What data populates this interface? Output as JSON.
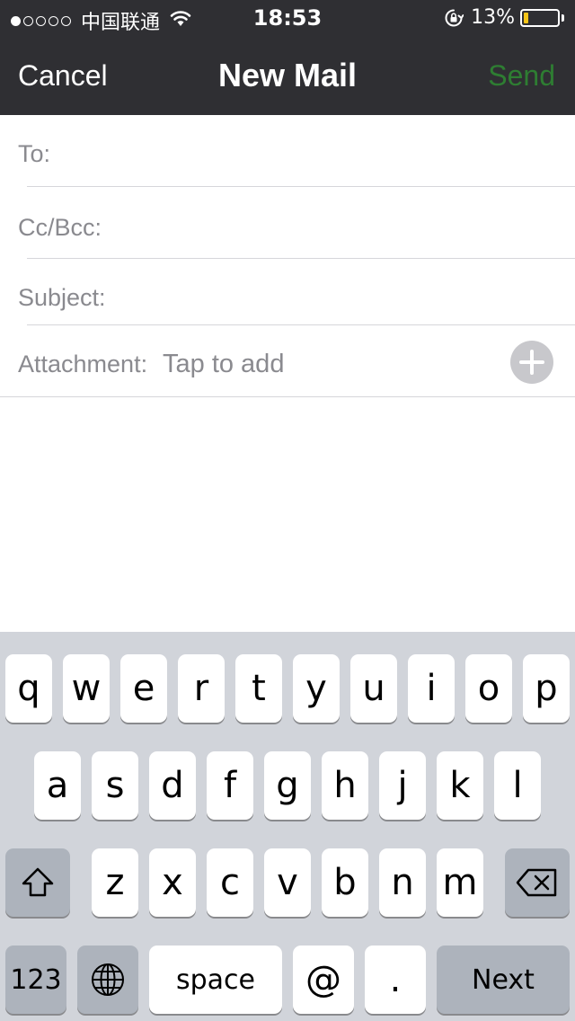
{
  "status_bar": {
    "carrier": "中国联通",
    "signal_dots": 5,
    "signal_filled": 1,
    "time": "18:53",
    "battery_percent_label": "13%",
    "battery_level": 0.13,
    "battery_color": "#f5c518",
    "icons": [
      "wifi-icon",
      "rotation-lock-icon",
      "battery-icon"
    ]
  },
  "nav": {
    "cancel_label": "Cancel",
    "title": "New Mail",
    "send_label": "Send",
    "send_color": "#2e7d32"
  },
  "form": {
    "to_label": "To:",
    "ccbcc_label": "Cc/Bcc:",
    "subject_label": "Subject:",
    "attachment_label": "Attachment:",
    "attachment_value": "Tap to add",
    "add_icon": "plus-icon"
  },
  "keyboard": {
    "row1": [
      "q",
      "w",
      "e",
      "r",
      "t",
      "y",
      "u",
      "i",
      "o",
      "p"
    ],
    "row2": [
      "a",
      "s",
      "d",
      "f",
      "g",
      "h",
      "j",
      "k",
      "l"
    ],
    "row3": [
      "z",
      "x",
      "c",
      "v",
      "b",
      "n",
      "m"
    ],
    "shift_icon": "shift-icon",
    "delete_icon": "delete-icon",
    "numbers_label": "123",
    "globe_icon": "globe-icon",
    "space_label": "space",
    "at_label": "@",
    "dot_label": ".",
    "next_label": "Next"
  }
}
